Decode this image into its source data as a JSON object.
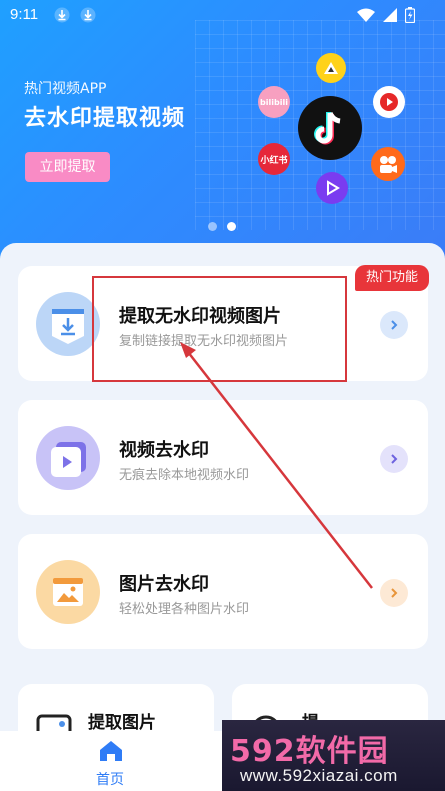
{
  "status_bar": {
    "time": "9:11"
  },
  "banner": {
    "subtitle": "热门视频APP",
    "title": "去水印提取视频",
    "button_label": "立即提取",
    "apps": [
      {
        "name": "bilibili",
        "label": "bilibili",
        "color": "#f7a0c0"
      },
      {
        "name": "xiaohongshu",
        "label": "小红书",
        "color": "#e6283a"
      },
      {
        "name": "tiktok",
        "label": "",
        "color": "#111111"
      },
      {
        "name": "kuaishou",
        "label": "",
        "color": "#ff6a1a"
      },
      {
        "name": "weishi",
        "label": "",
        "color": "#7a3cf0"
      },
      {
        "name": "yellow-app",
        "label": "",
        "color": "#ffd21a"
      },
      {
        "name": "red-play",
        "label": "",
        "color": "#ffffff"
      }
    ],
    "page_dots": 2,
    "active_dot": 2
  },
  "cards": [
    {
      "title": "提取无水印视频图片",
      "desc": "复制链接提取无水印视频图片",
      "icon_color": "#bcd6f7",
      "arrow_bg": "#dbe8fb",
      "arrow_color": "#4b8fe8",
      "badge": "热门功能"
    },
    {
      "title": "视频去水印",
      "desc": "无痕去除本地视频水印",
      "icon_color": "#c8c3f7",
      "arrow_bg": "#e4e2fb",
      "arrow_color": "#6e63df"
    },
    {
      "title": "图片去水印",
      "desc": "轻松处理各种图片水印",
      "icon_color": "#fbd9a3",
      "arrow_bg": "#fde9d5",
      "arrow_color": "#e8953a"
    }
  ],
  "mini_cards": [
    {
      "title": "提取图片"
    },
    {
      "title": "提"
    }
  ],
  "tabbar": {
    "home_label": "首页",
    "accent": "#2f7cf6"
  },
  "watermark": {
    "brand": "592软件园",
    "url": "www.592xiazai.com"
  }
}
